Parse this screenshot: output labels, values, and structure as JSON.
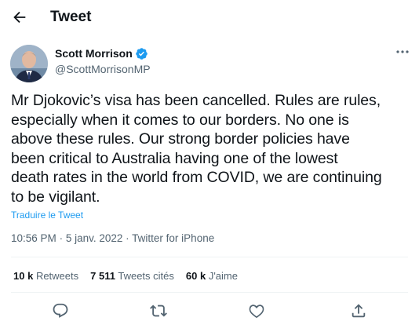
{
  "header": {
    "title": "Tweet"
  },
  "author": {
    "name": "Scott Morrison",
    "handle": "@ScottMorrisonMP"
  },
  "tweet": {
    "text": "Mr Djokovic’s visa has been cancelled. Rules are rules,\nespecially when it comes to our borders. No one is\nabove these rules. Our strong border policies have\nbeen critical to Australia having one of the lowest\ndeath rates in the world from COVID, we are continuing\nto be vigilant.",
    "translate_label": "Traduire le Tweet",
    "time": "10:56 PM",
    "date": "5 janv. 2022",
    "source": "Twitter for iPhone",
    "separator": "·"
  },
  "stats": {
    "retweets": {
      "count": "10 k",
      "label": "Retweets"
    },
    "quotes": {
      "count": "7 511",
      "label": "Tweets cités"
    },
    "likes": {
      "count": "60 k",
      "label": "J'aime"
    }
  },
  "icons": {
    "back": "arrow-left-icon",
    "verified": "verified-badge-icon",
    "more": "more-icon",
    "reply": "reply-icon",
    "retweet": "retweet-icon",
    "like": "heart-icon",
    "share": "share-icon"
  },
  "colors": {
    "accent": "#1d9bf0",
    "text": "#0f1419",
    "secondary": "#536471",
    "border": "#eff3f4"
  }
}
